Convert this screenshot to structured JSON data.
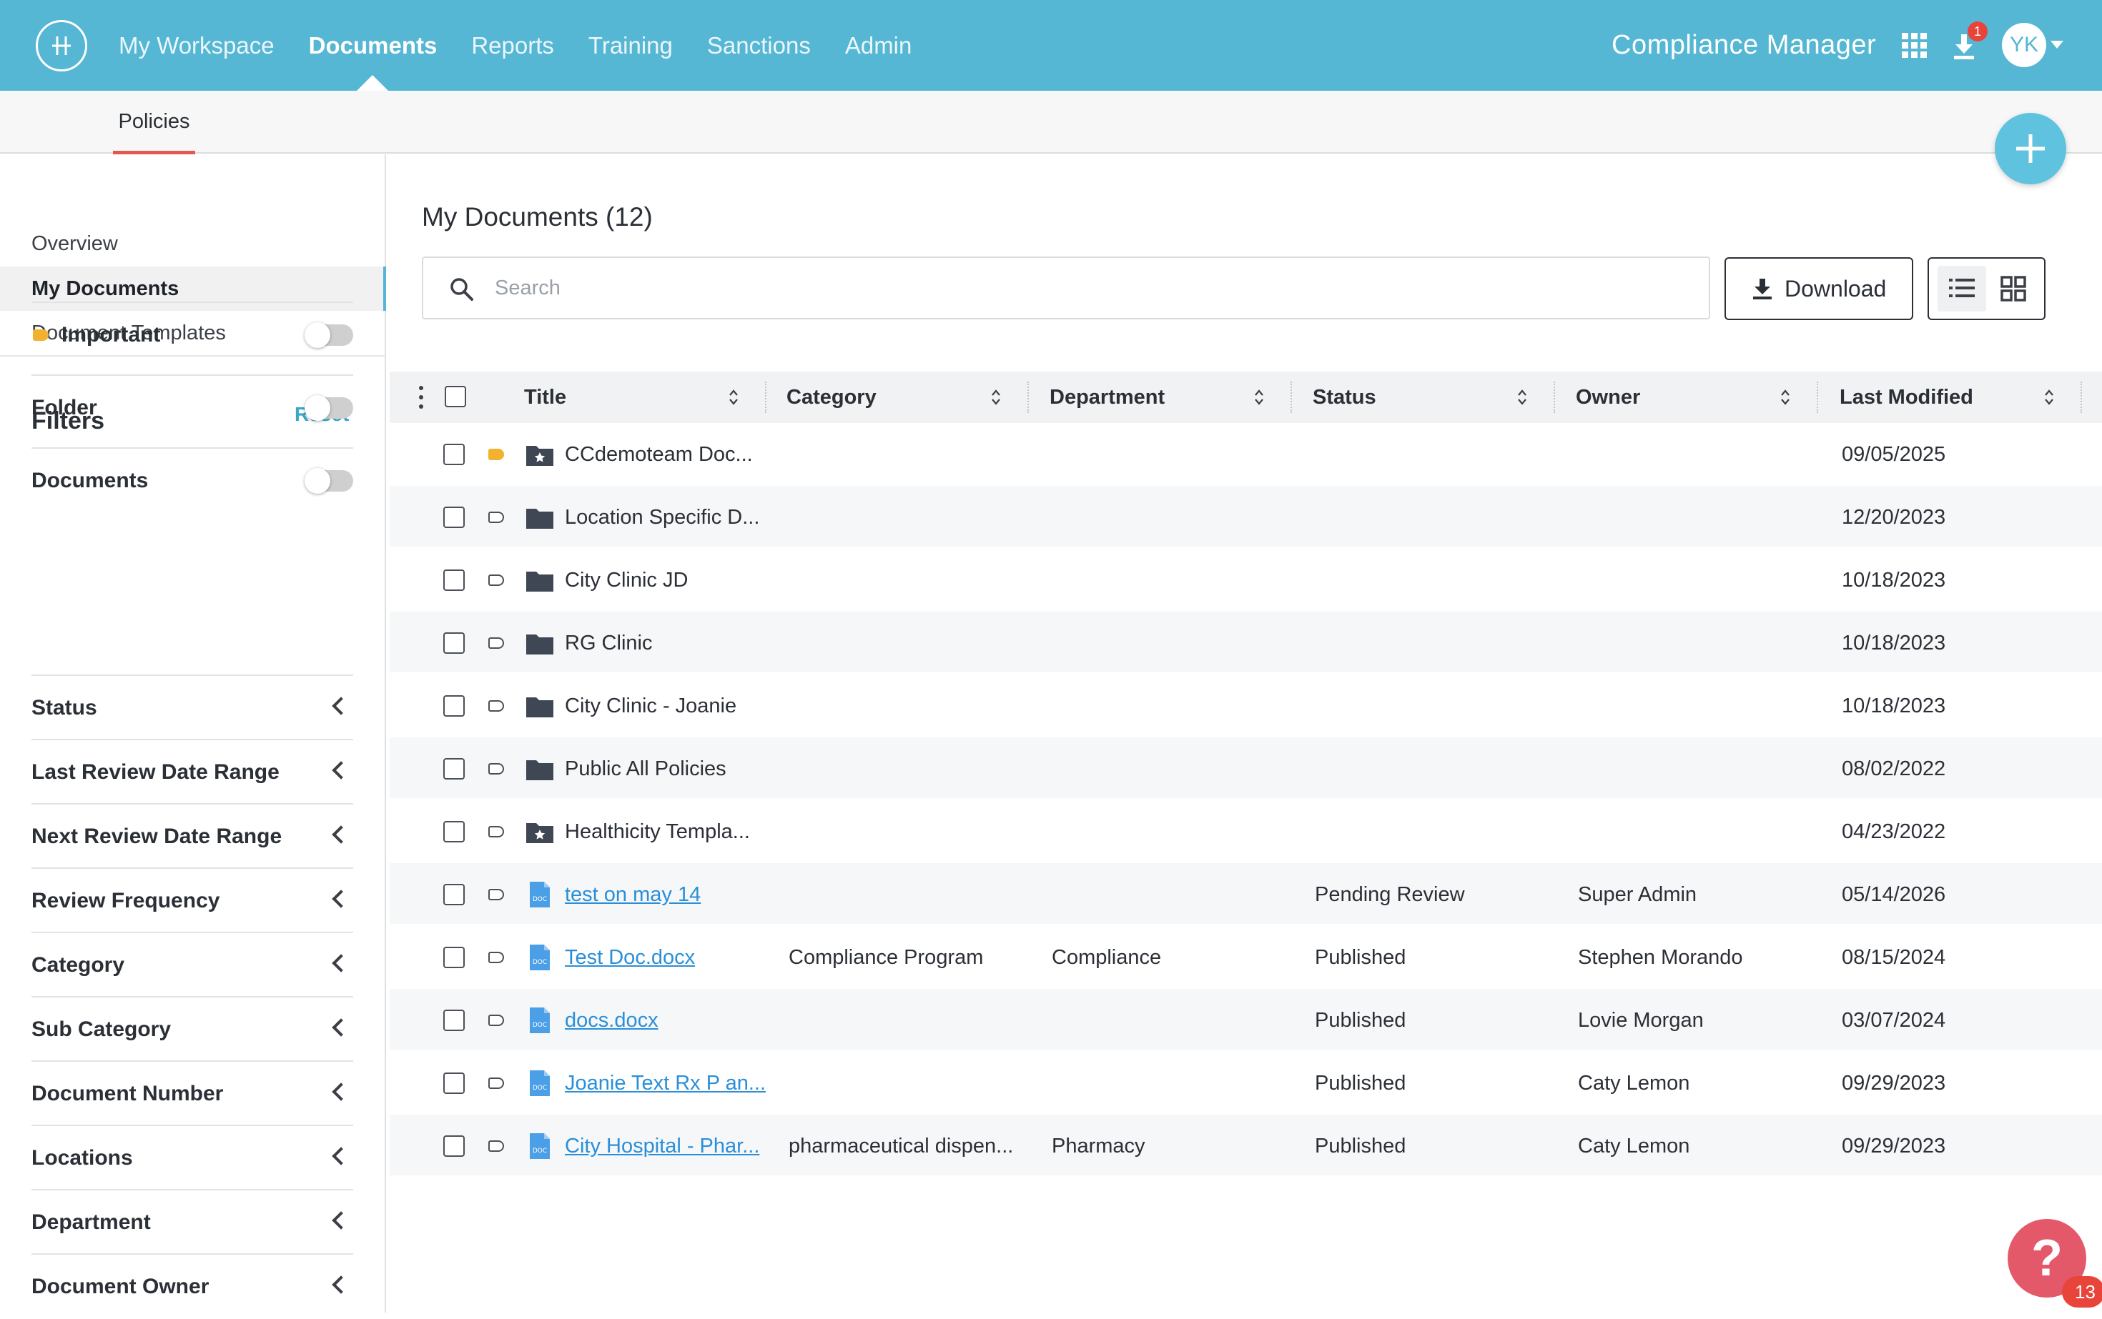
{
  "topbar": {
    "nav": [
      "My Workspace",
      "Documents",
      "Reports",
      "Training",
      "Sanctions",
      "Admin"
    ],
    "active_nav": "Documents",
    "app_title": "Compliance Manager",
    "download_badge": "1",
    "avatar_initials": "YK"
  },
  "subnav": {
    "tab": "Policies"
  },
  "sidebar": {
    "links": [
      "Overview",
      "My Documents",
      "Document Templates"
    ],
    "active_link": "My Documents",
    "filters_title": "Filters",
    "reset_label": "Reset",
    "toggles": [
      {
        "label": "Important",
        "on": false
      },
      {
        "label": "Folder",
        "on": false
      },
      {
        "label": "Documents",
        "on": false
      }
    ],
    "collapsibles": [
      "Status",
      "Last Review Date Range",
      "Next Review Date Range",
      "Review Frequency",
      "Category",
      "Sub Category",
      "Document Number",
      "Locations",
      "Department",
      "Document Owner"
    ]
  },
  "main": {
    "title": "My Documents (12)",
    "search_placeholder": "Search",
    "download_label": "Download"
  },
  "table": {
    "columns": [
      "Title",
      "Category",
      "Department",
      "Status",
      "Owner",
      "Last Modified"
    ],
    "rows": [
      {
        "type": "folder-star",
        "important": true,
        "title": "CCdemoteam Doc...",
        "category": "",
        "department": "",
        "status": "",
        "owner": "",
        "modified": "09/05/2025"
      },
      {
        "type": "folder",
        "important": false,
        "title": "Location Specific D...",
        "category": "",
        "department": "",
        "status": "",
        "owner": "",
        "modified": "12/20/2023"
      },
      {
        "type": "folder",
        "important": false,
        "title": "City Clinic JD",
        "category": "",
        "department": "",
        "status": "",
        "owner": "",
        "modified": "10/18/2023"
      },
      {
        "type": "folder",
        "important": false,
        "title": "RG Clinic",
        "category": "",
        "department": "",
        "status": "",
        "owner": "",
        "modified": "10/18/2023"
      },
      {
        "type": "folder",
        "important": false,
        "title": "City Clinic - Joanie",
        "category": "",
        "department": "",
        "status": "",
        "owner": "",
        "modified": "10/18/2023"
      },
      {
        "type": "folder",
        "important": false,
        "title": "Public All Policies",
        "category": "",
        "department": "",
        "status": "",
        "owner": "",
        "modified": "08/02/2022"
      },
      {
        "type": "folder-star",
        "important": false,
        "title": "Healthicity Templa...",
        "category": "",
        "department": "",
        "status": "",
        "owner": "",
        "modified": "04/23/2022"
      },
      {
        "type": "doc",
        "important": false,
        "title": "test on may 14",
        "category": "",
        "department": "",
        "status": "Pending Review",
        "owner": "Super Admin",
        "modified": "05/14/2026"
      },
      {
        "type": "doc",
        "important": false,
        "title": "Test Doc.docx",
        "category": "Compliance Program",
        "department": "Compliance",
        "status": "Published",
        "owner": "Stephen Morando",
        "modified": "08/15/2024"
      },
      {
        "type": "doc",
        "important": false,
        "title": "docs.docx",
        "category": "",
        "department": "",
        "status": "Published",
        "owner": "Lovie Morgan",
        "modified": "03/07/2024"
      },
      {
        "type": "doc",
        "important": false,
        "title": "Joanie Text Rx P an...",
        "category": "",
        "department": "",
        "status": "Published",
        "owner": "Caty Lemon",
        "modified": "09/29/2023"
      },
      {
        "type": "doc",
        "important": false,
        "title": "City Hospital - Phar...",
        "category": "pharmaceutical dispen...",
        "department": "Pharmacy",
        "status": "Published",
        "owner": "Caty Lemon",
        "modified": "09/29/2023"
      }
    ]
  },
  "help": {
    "label": "?",
    "badge": "13"
  },
  "colors": {
    "topbar": "#55b7d3",
    "accent_underline": "#e25a4f",
    "link": "#2a8fd8",
    "important": "#f2b230",
    "help": "#e4596a"
  }
}
